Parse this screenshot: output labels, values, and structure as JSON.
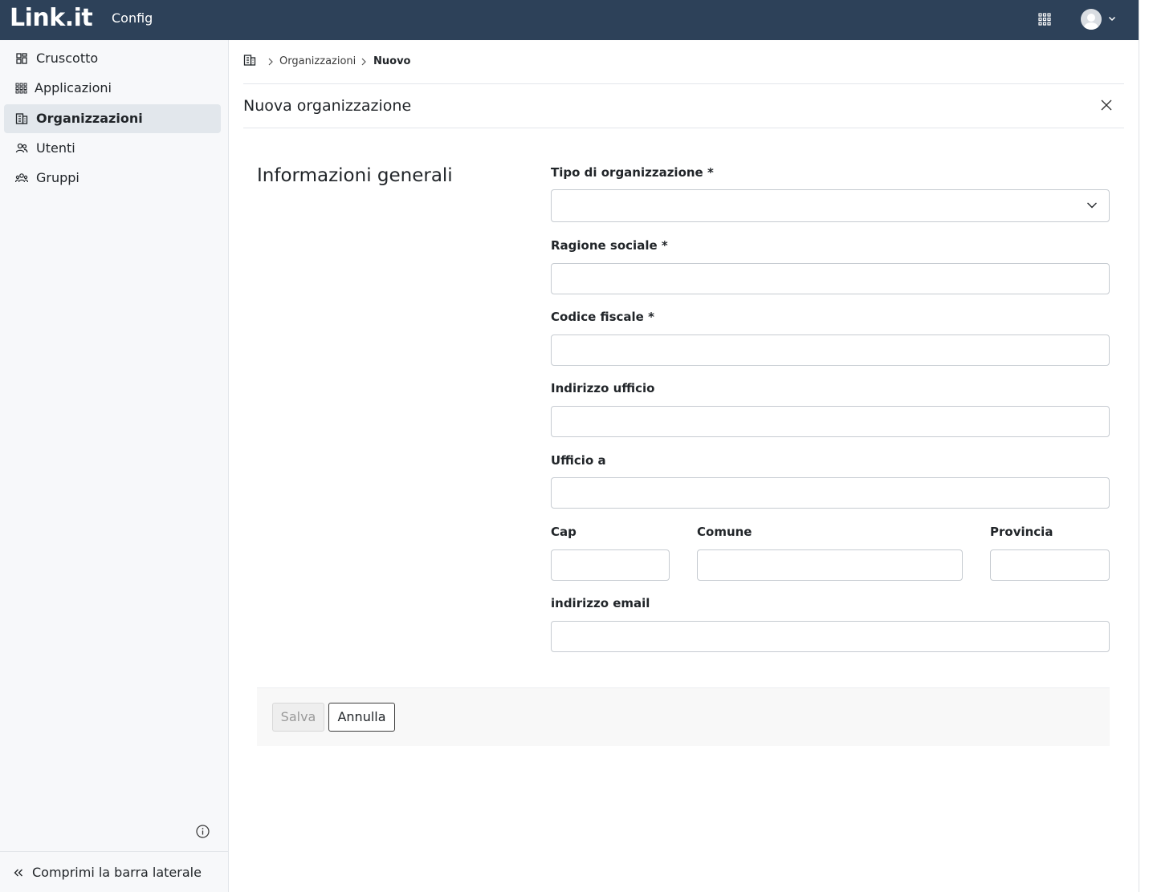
{
  "topbar": {
    "logo": "Link.it",
    "app_name": "Config",
    "apps_icon": "grid-icon",
    "user_icon": "user-avatar-icon"
  },
  "sidebar": {
    "items": [
      {
        "label": "Cruscotto",
        "icon": "dashboard-icon",
        "active": false
      },
      {
        "label": "Applicazioni",
        "icon": "apps-grid-icon",
        "active": false
      },
      {
        "label": "Organizzazioni",
        "icon": "building-icon",
        "active": true
      },
      {
        "label": "Utenti",
        "icon": "users-icon",
        "active": false
      },
      {
        "label": "Gruppi",
        "icon": "group-icon",
        "active": false
      }
    ],
    "collapse_label": "Comprimi la barra laterale"
  },
  "breadcrumb": {
    "items": [
      "Organizzazioni",
      "Nuovo"
    ]
  },
  "page": {
    "title": "Nuova organizzazione"
  },
  "form": {
    "section_title": "Informazioni generali",
    "tipo": {
      "label": "Tipo di organizzazione *",
      "value": ""
    },
    "ragione_sociale": {
      "label": "Ragione sociale *",
      "value": ""
    },
    "codice_fiscale": {
      "label": "Codice fiscale *",
      "value": ""
    },
    "indirizzo": {
      "label": "Indirizzo ufficio",
      "value": ""
    },
    "ufficio_a": {
      "label": "Ufficio a",
      "value": ""
    },
    "cap": {
      "label": "Cap",
      "value": ""
    },
    "comune": {
      "label": "Comune",
      "value": ""
    },
    "provincia": {
      "label": "Provincia",
      "value": ""
    },
    "email": {
      "label": "indirizzo email",
      "value": ""
    }
  },
  "actions": {
    "save_label": "Salva",
    "cancel_label": "Annulla"
  },
  "colors": {
    "topbar": "#2d4159",
    "sidebar_bg": "#f7f8fa",
    "active_item": "#e2e7ec"
  }
}
